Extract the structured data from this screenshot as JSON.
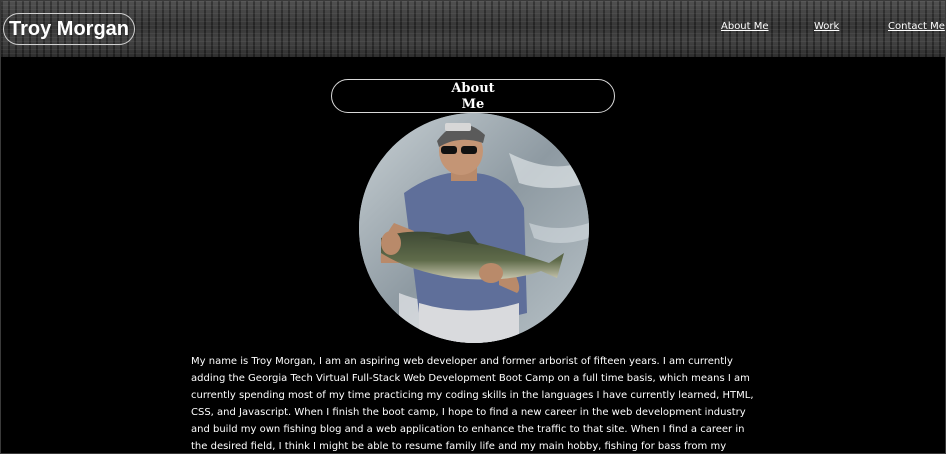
{
  "header": {
    "brand_name": "Troy Morgan",
    "nav": {
      "about": "About Me",
      "work": "Work",
      "contact": "Contact Me"
    }
  },
  "about_section": {
    "title": "About Me",
    "bio": "My name is Troy Morgan, I am an aspiring web developer and former arborist of fifteen years. I am currently adding the Georgia Tech Virtual Full-Stack Web Development Boot Camp on a full time basis, which means I am currently spending most of my time practicing my coding skills in the languages I have currently learned, HTML, CSS, and Javascript. When I finish the boot camp, I hope to find a new career in the web development industry and build my own fishing blog and a web application to enhance the traffic to that site. When I find a career in the desired field, I think I might be able to resume family life and my main hobby, fishing for bass from my kayaks."
  },
  "colors": {
    "background": "#000000",
    "text": "#ffffff",
    "border": "#d9d9d9"
  }
}
